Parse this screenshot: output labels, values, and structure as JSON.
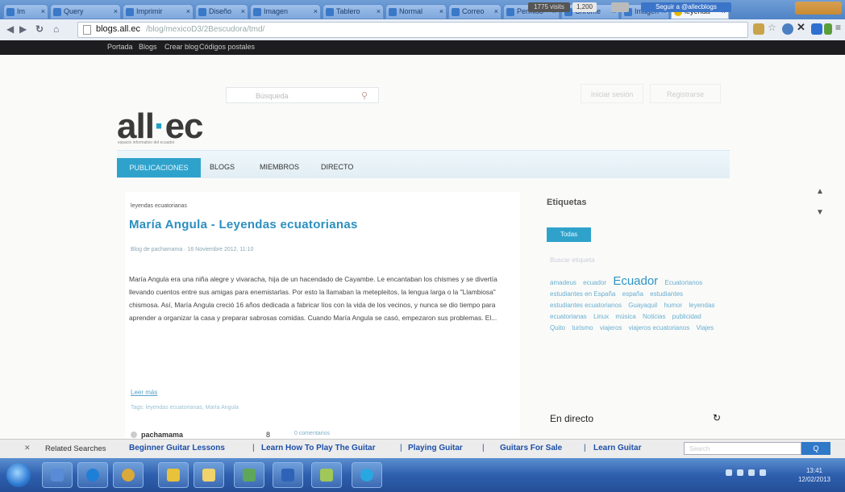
{
  "browser": {
    "tabs": [
      {
        "label": "Im"
      },
      {
        "label": "Query"
      },
      {
        "label": "Imprimir"
      },
      {
        "label": "Diseño"
      },
      {
        "label": "Imagen"
      },
      {
        "label": "Tablero"
      },
      {
        "label": "Normal"
      },
      {
        "label": "Correo"
      },
      {
        "label": "Permiso"
      },
      {
        "label": "Chrome"
      },
      {
        "label": "Imagen"
      },
      {
        "label": "leyenda"
      }
    ],
    "close_glyph": "×",
    "url": "blogs.all.ec",
    "url_rest": "/blog/mexicoD3/2Bescudora/tmd/"
  },
  "site_bar": {
    "links": [
      "Portada",
      "Blogs",
      "Crear blog",
      "Códigos postales"
    ],
    "stat1": "1775 visits",
    "stat2": "1,200",
    "twitter": "Seguir a @allecblogs"
  },
  "header": {
    "search_placeholder": "Búsqueda",
    "search_icon": "search-icon",
    "login": "Iniciar sesión",
    "register": "Registrarse",
    "logo_left": "all",
    "logo_dot": "·",
    "logo_right": "ec",
    "tagline": "espacio informativo del ecuador"
  },
  "nav": {
    "items": [
      "PUBLICACIONES",
      "BLOGS",
      "MIEMBROS",
      "DIRECTO"
    ]
  },
  "post": {
    "category": "leyendas ecuatorianas",
    "title": "María Angula - Leyendas ecuatorianas",
    "byline": "Blog de pachamama · 16 Noviembre 2012, 11:10",
    "body": "María Angula era una niña alegre y vivaracha, hija de un hacendado de Cayambe. Le encantaban los chismes y se divertía llevando cuentos entre sus amigas para enemistarlas. Por esto la llamaban la metepleitos, la lengua larga o la \"Llambiosa\" chismosa. Así, María Angula creció 16 años dedicada a fabricar líos con la vida de los vecinos, y nunca se dio tiempo para aprender a organizar la casa y preparar sabrosas comidas. Cuando María Angula se casó, empezaron sus problemas. El...",
    "read_more": "Leer más",
    "tags": "Tags: leyendas ecuatorianas, María Angula",
    "author": "pachamama",
    "count": "8",
    "comments": "0 comentarios"
  },
  "sidebar": {
    "etiquetas_title": "Etiquetas",
    "todas": "Todas",
    "buscar_placeholder": "Buscar etiqueta",
    "tags": [
      "amadeus",
      "ecuador",
      "Ecuador",
      "Ecuatorianos",
      "estudiantes en España",
      "españa",
      "estudiantes",
      "estudiantes ecuatorianos",
      "Guayaquil",
      "humor",
      "leyendas ecuatorianas",
      "Linux",
      "música",
      "Noticias",
      "publicidad",
      "Quito",
      "turismo",
      "viajeros",
      "viajeros ecuatorianos",
      "Viajes"
    ],
    "featured_tag": "Ecuador",
    "en_directo": "En directo",
    "en_directo_icon": "refresh-icon"
  },
  "related": {
    "label": "Related Searches",
    "links": [
      "Beginner Guitar Lessons",
      "Learn How To Play The Guitar",
      "Playing Guitar",
      "Guitars For Sale",
      "Learn Guitar"
    ],
    "separator": "|",
    "search_placeholder": "Search",
    "go": "Q"
  },
  "taskbar": {
    "clock_time": "13:41",
    "clock_date": "12/02/2013"
  },
  "colors": {
    "accent": "#2fa2cc",
    "title": "#2b8fc0",
    "related_link": "#1c4fa8"
  }
}
